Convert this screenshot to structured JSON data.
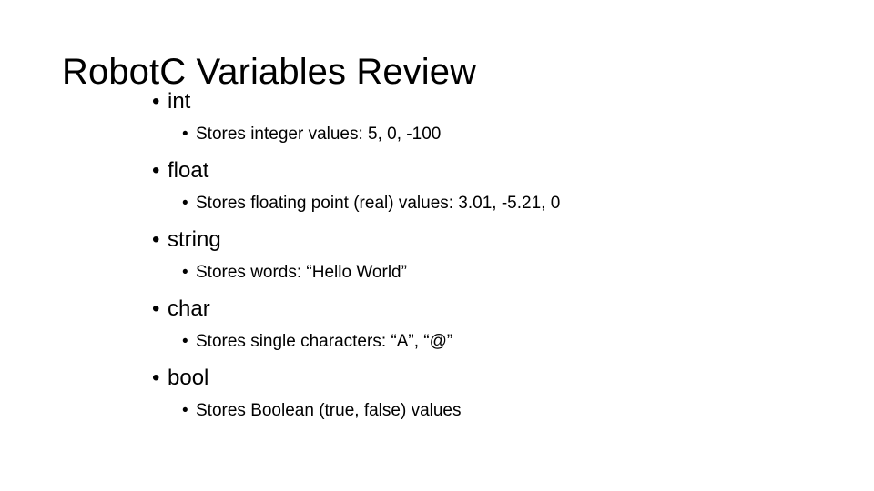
{
  "slide": {
    "title": "RobotC Variables Review",
    "bullet_glyph": "•",
    "background_color": "#ffffff",
    "text_color": "#000000",
    "groups": [
      {
        "term": "int",
        "description": "Stores integer values: 5, 0, -100"
      },
      {
        "term": "float",
        "description": "Stores floating point (real) values: 3.01, -5.21, 0"
      },
      {
        "term": "string",
        "description": "Stores words: “Hello World”"
      },
      {
        "term": "char",
        "description": "Stores single characters: “A”, “@”"
      },
      {
        "term": "bool",
        "description": "Stores Boolean (true, false) values"
      }
    ]
  }
}
